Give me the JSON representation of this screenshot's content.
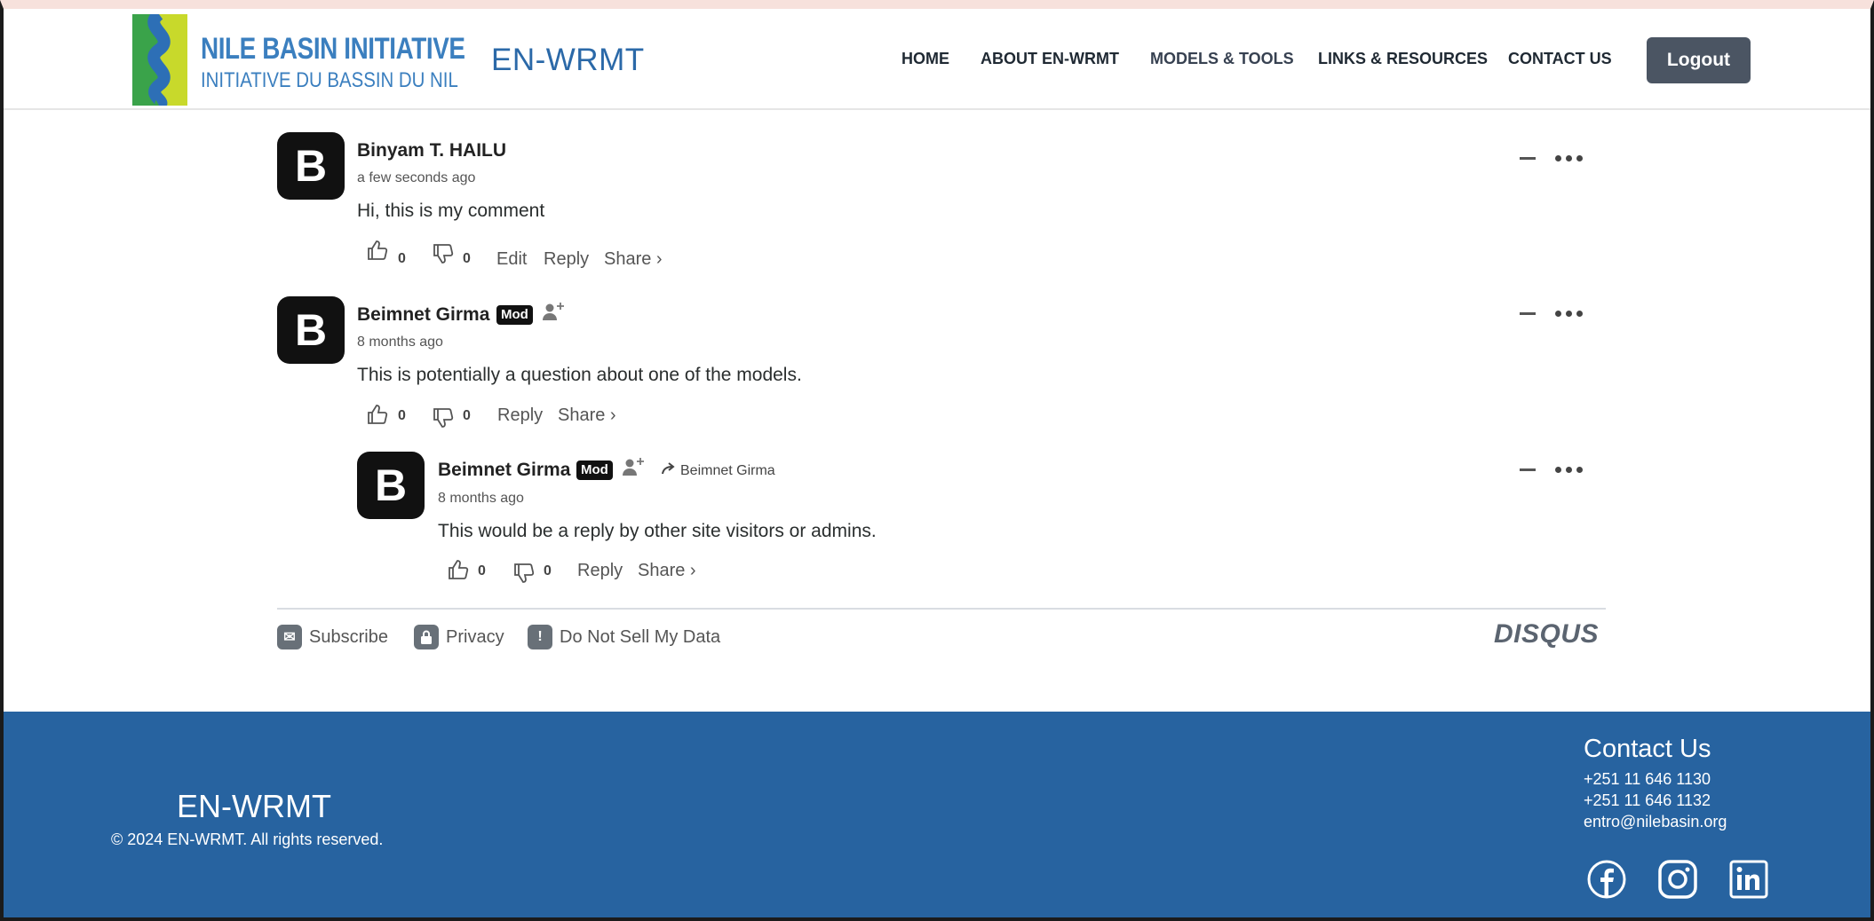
{
  "header": {
    "logo_line1": "NILE BASIN INITIATIVE",
    "logo_line2": "INITIATIVE DU BASSIN DU NIL",
    "site_name": "EN-WRMT",
    "nav": [
      "HOME",
      "ABOUT EN-WRMT",
      "MODELS & TOOLS",
      "LINKS & RESOURCES",
      "CONTACT US"
    ],
    "logout_label": "Logout"
  },
  "comments": [
    {
      "avatar_letter": "B",
      "author": "Binyam T. HAILU",
      "time": "a few seconds ago",
      "text": "Hi, this is my comment",
      "upvotes": "0",
      "downvotes": "0",
      "edit_label": "Edit",
      "reply_label": "Reply",
      "share_label": "Share ›"
    },
    {
      "avatar_letter": "B",
      "author": "Beimnet Girma",
      "badge": "Mod",
      "time": "8 months ago",
      "text": "This is potentially a question about one of the models.",
      "upvotes": "0",
      "downvotes": "0",
      "reply_label": "Reply",
      "share_label": "Share ›"
    },
    {
      "avatar_letter": "B",
      "author": "Beimnet Girma",
      "badge": "Mod",
      "in_reply_to": "Beimnet Girma",
      "time": "8 months ago",
      "text": "This would be a reply by other site visitors or admins.",
      "upvotes": "0",
      "downvotes": "0",
      "reply_label": "Reply",
      "share_label": "Share ›"
    }
  ],
  "disqus_footer": {
    "subscribe": "Subscribe",
    "privacy": "Privacy",
    "do_not_sell": "Do Not Sell My Data",
    "brand": "DISQUS"
  },
  "footer": {
    "brand": "EN-WRMT",
    "copyright": "© 2024 EN-WRMT. All rights reserved.",
    "contact_heading": "Contact Us",
    "phone1": "+251 11 646 1130",
    "phone2": "+251 11 646 1132",
    "email": "entro@nilebasin.org",
    "social_icons": [
      "facebook-icon",
      "instagram-icon",
      "linkedin-icon"
    ]
  },
  "colors": {
    "brand_blue": "#2763a0",
    "logout_bg": "#4b5563",
    "logo_blue": "#3b7fbf"
  }
}
